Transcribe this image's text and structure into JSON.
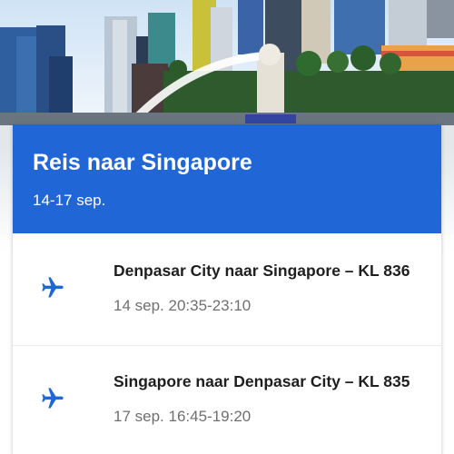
{
  "trip": {
    "title": "Reis naar Singapore",
    "dates": "14-17 sep."
  },
  "flights": [
    {
      "route": "Denpasar City naar Singapore – KL 836",
      "time": "14 sep. 20:35-23:10",
      "icon": "airplane-icon"
    },
    {
      "route": "Singapore naar Denpasar City – KL 835",
      "time": "17 sep. 16:45-19:20",
      "icon": "airplane-icon"
    }
  ],
  "colors": {
    "header": "#2166d6",
    "icon": "#2166d6",
    "route_text": "#1f1f1f",
    "time_text": "#6f6f6f"
  }
}
